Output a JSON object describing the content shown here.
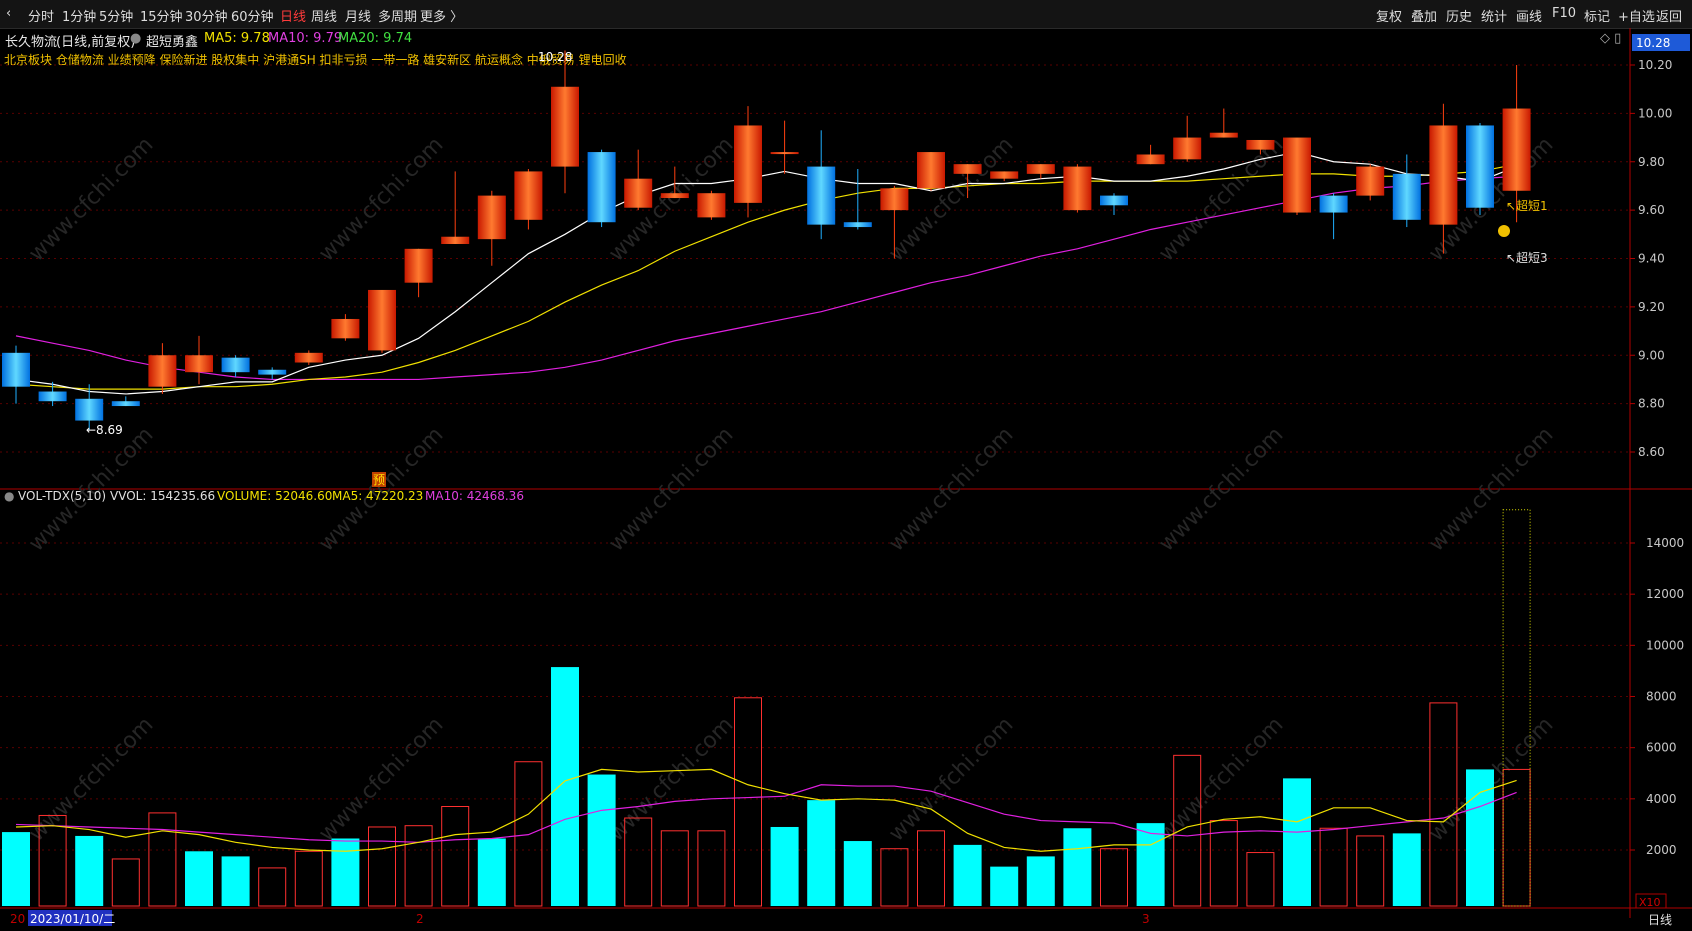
{
  "toolbar": {
    "nav_back": "‹",
    "periods": [
      "分时",
      "1分钟",
      "5分钟",
      "15分钟",
      "30分钟",
      "60分钟",
      "日线",
      "周线",
      "月线",
      "多周期",
      "更多 〉"
    ],
    "active_period": "日线",
    "right_buttons": [
      "复权",
      "叠加",
      "历史",
      "统计",
      "画线",
      "F10",
      "标记",
      "+自选",
      "返回"
    ]
  },
  "header": {
    "stock_name": "长久物流",
    "mode": "(日线,前复权)",
    "indicator_name": "超短勇鑫",
    "ma5_label": "MA5: 9.78",
    "ma10_label": "MA10: 9.79",
    "ma20_label": "MA20: 9.74",
    "right_icons": "◇  ▯",
    "current_price": "10.28",
    "concepts": "北京板块  仓储物流  业绩预降  保险新进  股权集中  沪港通SH  扣非亏损   一带一路  雄安新区  航运概念  中俄贸易  锂电回收"
  },
  "volume_header": {
    "label": "VOL-TDX(5,10)",
    "vvol": "VVOL: 154235.66",
    "volume": "VOLUME: 52046.60",
    "ma5": "MA5: 47220.23",
    "ma10": "MA10: 42468.36"
  },
  "annotations": {
    "low_label": "←8.69",
    "high_label": "10.28",
    "signal1": "↖超短1",
    "signal3": "↖超短3",
    "yu_badge": "预",
    "x10": "X10",
    "period_footer": "日线",
    "date_label": "2023/01/10/二",
    "date_start": "20",
    "month2": "2",
    "month3": "3"
  },
  "watermark": "www.cfchi.com",
  "colors": {
    "up": "#ff4010",
    "down": "#20b0ff",
    "ma5": "#ffffff",
    "ma10": "#f0e000",
    "ma20": "#e020e0",
    "vol_up": "#ff3030",
    "vol_down": "#00ffff",
    "axis_red": "#b00000"
  },
  "chart_data": [
    {
      "type": "candlestick",
      "title": "长久物流 (日线,前复权)",
      "ylim": [
        8.5,
        10.35
      ],
      "y_ticks": [
        8.6,
        8.8,
        9.0,
        9.2,
        9.4,
        9.6,
        9.8,
        10.0,
        10.2
      ],
      "candles": [
        {
          "o": 9.01,
          "h": 9.04,
          "l": 8.8,
          "c": 8.87
        },
        {
          "o": 8.85,
          "h": 8.89,
          "l": 8.79,
          "c": 8.81
        },
        {
          "o": 8.82,
          "h": 8.88,
          "l": 8.69,
          "c": 8.73
        },
        {
          "o": 8.81,
          "h": 8.83,
          "l": 8.79,
          "c": 8.79
        },
        {
          "o": 8.87,
          "h": 9.05,
          "l": 8.84,
          "c": 9.0
        },
        {
          "o": 8.93,
          "h": 9.08,
          "l": 8.88,
          "c": 9.0
        },
        {
          "o": 8.99,
          "h": 9.0,
          "l": 8.91,
          "c": 8.93
        },
        {
          "o": 8.94,
          "h": 8.95,
          "l": 8.9,
          "c": 8.92
        },
        {
          "o": 8.97,
          "h": 9.02,
          "l": 8.96,
          "c": 9.01
        },
        {
          "o": 9.07,
          "h": 9.17,
          "l": 9.06,
          "c": 9.15
        },
        {
          "o": 9.02,
          "h": 9.27,
          "l": 9.01,
          "c": 9.27
        },
        {
          "o": 9.3,
          "h": 9.44,
          "l": 9.24,
          "c": 9.44
        },
        {
          "o": 9.46,
          "h": 9.76,
          "l": 9.46,
          "c": 9.49
        },
        {
          "o": 9.48,
          "h": 9.68,
          "l": 9.37,
          "c": 9.66
        },
        {
          "o": 9.56,
          "h": 9.77,
          "l": 9.52,
          "c": 9.76
        },
        {
          "o": 9.78,
          "h": 10.26,
          "l": 9.67,
          "c": 10.11
        },
        {
          "o": 9.84,
          "h": 9.85,
          "l": 9.53,
          "c": 9.55
        },
        {
          "o": 9.61,
          "h": 9.85,
          "l": 9.6,
          "c": 9.73
        },
        {
          "o": 9.65,
          "h": 9.78,
          "l": 9.65,
          "c": 9.67
        },
        {
          "o": 9.57,
          "h": 9.68,
          "l": 9.56,
          "c": 9.67
        },
        {
          "o": 9.63,
          "h": 10.03,
          "l": 9.57,
          "c": 9.95
        },
        {
          "o": 9.84,
          "h": 9.97,
          "l": 9.75,
          "c": 9.84
        },
        {
          "o": 9.78,
          "h": 9.93,
          "l": 9.48,
          "c": 9.54
        },
        {
          "o": 9.55,
          "h": 9.77,
          "l": 9.52,
          "c": 9.53
        },
        {
          "o": 9.6,
          "h": 9.7,
          "l": 9.4,
          "c": 9.69
        },
        {
          "o": 9.69,
          "h": 9.84,
          "l": 9.68,
          "c": 9.84
        },
        {
          "o": 9.75,
          "h": 9.79,
          "l": 9.65,
          "c": 9.79
        },
        {
          "o": 9.73,
          "h": 9.76,
          "l": 9.72,
          "c": 9.76
        },
        {
          "o": 9.75,
          "h": 9.79,
          "l": 9.73,
          "c": 9.79
        },
        {
          "o": 9.6,
          "h": 9.79,
          "l": 9.59,
          "c": 9.78
        },
        {
          "o": 9.66,
          "h": 9.67,
          "l": 9.58,
          "c": 9.62
        },
        {
          "o": 9.79,
          "h": 9.87,
          "l": 9.79,
          "c": 9.83
        },
        {
          "o": 9.81,
          "h": 9.99,
          "l": 9.8,
          "c": 9.9
        },
        {
          "o": 9.9,
          "h": 10.02,
          "l": 9.9,
          "c": 9.92
        },
        {
          "o": 9.85,
          "h": 9.89,
          "l": 9.83,
          "c": 9.89
        },
        {
          "o": 9.59,
          "h": 9.89,
          "l": 9.58,
          "c": 9.9
        },
        {
          "o": 9.66,
          "h": 9.67,
          "l": 9.48,
          "c": 9.59
        },
        {
          "o": 9.66,
          "h": 9.79,
          "l": 9.64,
          "c": 9.78
        },
        {
          "o": 9.75,
          "h": 9.83,
          "l": 9.53,
          "c": 9.56
        },
        {
          "o": 9.54,
          "h": 10.04,
          "l": 9.42,
          "c": 9.95
        },
        {
          "o": 9.95,
          "h": 9.96,
          "l": 9.58,
          "c": 9.61
        },
        {
          "o": 9.68,
          "h": 10.2,
          "l": 9.55,
          "c": 10.02
        }
      ],
      "ma5": [
        8.9,
        8.88,
        8.85,
        8.84,
        8.85,
        8.87,
        8.89,
        8.89,
        8.95,
        8.98,
        9.0,
        9.07,
        9.18,
        9.3,
        9.42,
        9.5,
        9.59,
        9.66,
        9.71,
        9.71,
        9.73,
        9.76,
        9.73,
        9.71,
        9.71,
        9.68,
        9.71,
        9.71,
        9.73,
        9.74,
        9.72,
        9.72,
        9.74,
        9.77,
        9.81,
        9.84,
        9.8,
        9.79,
        9.75,
        9.74,
        9.72,
        9.78
      ],
      "ma10": [
        8.88,
        8.87,
        8.86,
        8.86,
        8.86,
        8.87,
        8.87,
        8.88,
        8.9,
        8.91,
        8.93,
        8.97,
        9.02,
        9.08,
        9.14,
        9.22,
        9.29,
        9.35,
        9.43,
        9.49,
        9.55,
        9.6,
        9.64,
        9.67,
        9.69,
        9.69,
        9.7,
        9.71,
        9.71,
        9.72,
        9.72,
        9.72,
        9.72,
        9.73,
        9.74,
        9.75,
        9.75,
        9.74,
        9.74,
        9.75,
        9.76,
        9.79
      ],
      "ma20": [
        9.08,
        9.05,
        9.02,
        8.98,
        8.95,
        8.93,
        8.91,
        8.9,
        8.9,
        8.9,
        8.9,
        8.9,
        8.91,
        8.92,
        8.93,
        8.95,
        8.98,
        9.02,
        9.06,
        9.09,
        9.12,
        9.15,
        9.18,
        9.22,
        9.26,
        9.3,
        9.33,
        9.37,
        9.41,
        9.44,
        9.48,
        9.52,
        9.55,
        9.58,
        9.61,
        9.64,
        9.67,
        9.69,
        9.7,
        9.72,
        9.73,
        9.74
      ]
    },
    {
      "type": "bar",
      "title": "VOL-TDX(5,10)",
      "ylim": [
        0,
        16000
      ],
      "y_ticks": [
        2000,
        4000,
        6000,
        8000,
        10000,
        12000,
        14000
      ],
      "values": [
        2700,
        3350,
        2550,
        1650,
        3450,
        1950,
        1750,
        1300,
        1950,
        2450,
        2900,
        2950,
        3700,
        2450,
        5450,
        9150,
        4950,
        3250,
        2750,
        2750,
        7950,
        2900,
        3950,
        2350,
        2050,
        2750,
        2200,
        1350,
        1750,
        2850,
        2050,
        3050,
        5700,
        3150,
        1900,
        4800,
        2850,
        2550,
        2650,
        7750,
        5150,
        5150
      ],
      "up": [
        false,
        true,
        false,
        true,
        true,
        false,
        false,
        true,
        true,
        false,
        true,
        true,
        true,
        false,
        true,
        false,
        false,
        true,
        true,
        true,
        true,
        false,
        false,
        false,
        true,
        true,
        false,
        false,
        false,
        false,
        true,
        false,
        true,
        true,
        true,
        false,
        true,
        true,
        false,
        true,
        false,
        true
      ],
      "last_projection": 15300,
      "ma5": [
        2900,
        2950,
        2800,
        2500,
        2750,
        2600,
        2300,
        2100,
        2000,
        1950,
        2050,
        2300,
        2600,
        2700,
        3400,
        4700,
        5150,
        5050,
        5100,
        5150,
        4550,
        4200,
        3950,
        4000,
        3950,
        3600,
        2650,
        2100,
        1950,
        2050,
        2200,
        2200,
        2900,
        3200,
        3300,
        3100,
        3650,
        3650,
        3150,
        3100,
        4250,
        4720
      ],
      "ma10": [
        3000,
        2950,
        2900,
        2850,
        2800,
        2700,
        2600,
        2500,
        2400,
        2350,
        2350,
        2300,
        2400,
        2450,
        2600,
        3200,
        3550,
        3700,
        3900,
        4000,
        4050,
        4100,
        4550,
        4500,
        4500,
        4300,
        3850,
        3400,
        3150,
        3100,
        3050,
        2650,
        2550,
        2700,
        2750,
        2700,
        2800,
        2950,
        3100,
        3250,
        3700,
        4250
      ]
    }
  ]
}
